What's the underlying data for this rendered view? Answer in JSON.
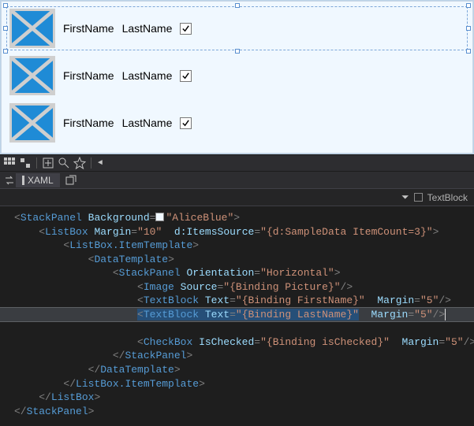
{
  "designer": {
    "panel_background": "AliceBlue",
    "item_count": 3,
    "first_name": "FirstName",
    "last_name": "LastName",
    "checked": true,
    "selected_row_index": 0
  },
  "toolbar": {
    "icons": [
      "grid-icon",
      "snap-icon",
      "divider",
      "zoom-fit-icon",
      "zoom-icon",
      "effects-icon",
      "divider",
      "chevron-left-icon"
    ]
  },
  "tab": {
    "label": "XAML"
  },
  "breadcrumb": {
    "drop_indicator": "⏷",
    "element": "TextBlock"
  },
  "code": {
    "l1_tag": "StackPanel",
    "l1_attr1": "Background",
    "l1_val1": "\"AliceBlue\"",
    "l2_tag": "ListBox",
    "l2_attr1": "Margin",
    "l2_val1": "\"10\"",
    "l2_attr2": "d:ItemsSource",
    "l2_val2": "\"{d:SampleData ItemCount=3}\"",
    "l3_tag": "ListBox.ItemTemplate",
    "l4_tag": "DataTemplate",
    "l5_tag": "StackPanel",
    "l5_attr1": "Orientation",
    "l5_val1": "\"Horizontal\"",
    "l6_tag": "Image",
    "l6_attr1": "Source",
    "l6_val1": "\"{Binding Picture}\"",
    "l7_tag": "TextBlock",
    "l7_attr1": "Text",
    "l7_val1": "\"{Binding FirstName}\"",
    "l7_attr2": "Margin",
    "l7_val2": "\"5\"",
    "l8_tag": "TextBlock",
    "l8_attr1": "Text",
    "l8_val1": "\"{Binding LastName}\"",
    "l8_attr2": "Margin",
    "l8_val2": "\"5\"",
    "l9_tag": "CheckBox",
    "l9_attr1": "IsChecked",
    "l9_val1": "\"{Binding isChecked}\"",
    "l9_attr2": "Margin",
    "l9_val2": "\"5\"",
    "l10_close": "StackPanel",
    "l11_close": "DataTemplate",
    "l12_close": "ListBox.ItemTemplate",
    "l13_close": "ListBox",
    "l14_close": "StackPanel"
  }
}
